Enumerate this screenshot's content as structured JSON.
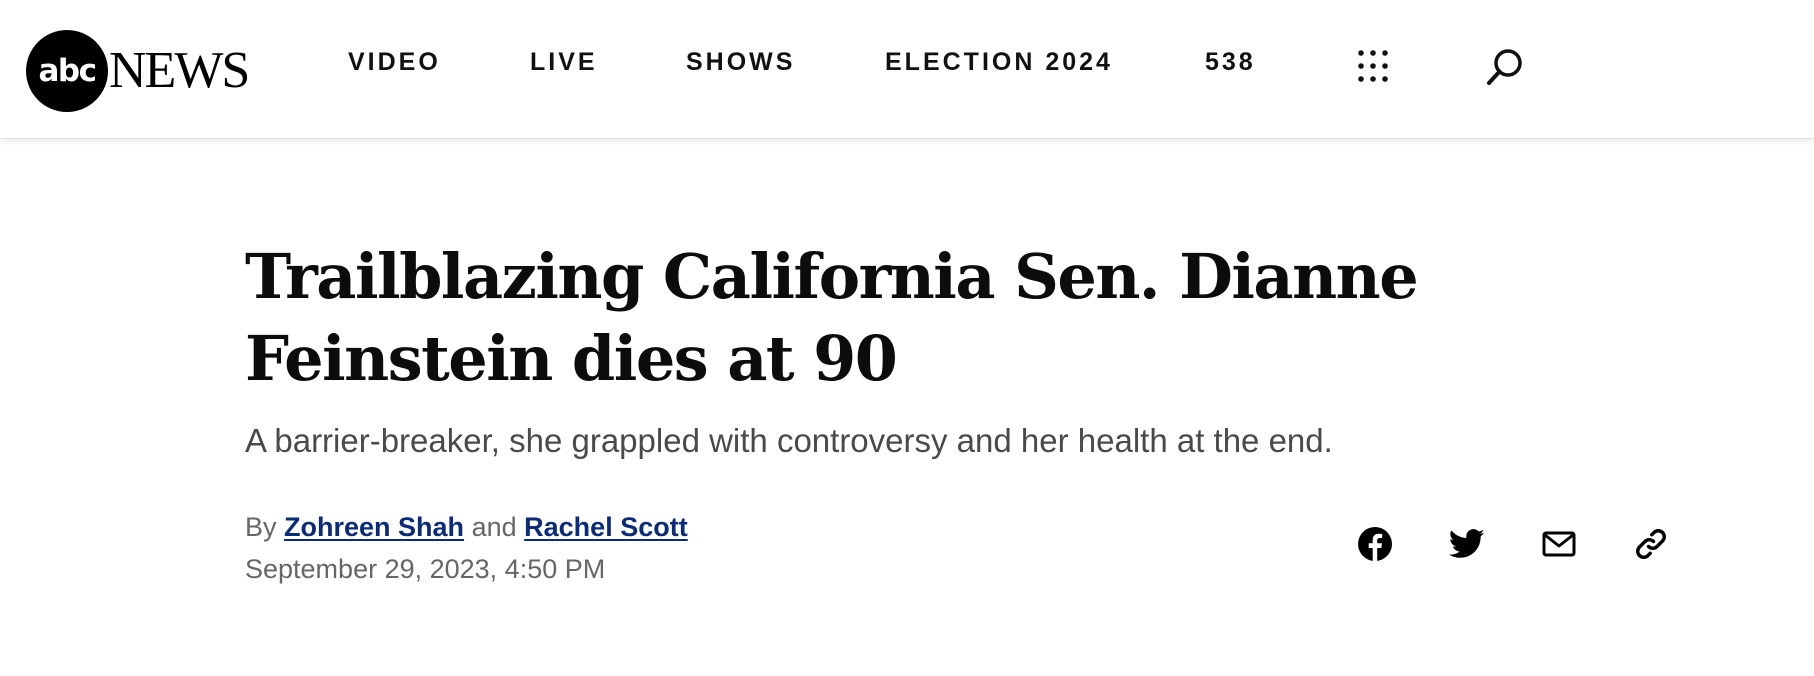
{
  "header": {
    "logo": {
      "mark": "abc",
      "word": "NEWS"
    },
    "nav": [
      {
        "label": "VIDEO"
      },
      {
        "label": "LIVE"
      },
      {
        "label": "SHOWS"
      },
      {
        "label": "ELECTION 2024"
      },
      {
        "label": "538"
      }
    ],
    "icons": {
      "menu": "grid-menu-icon",
      "search": "search-icon"
    }
  },
  "article": {
    "headline": "Trailblazing California Sen. Dianne Feinstein dies at 90",
    "subheadline": "A barrier-breaker, she grappled with controversy and her health at the end.",
    "byline": {
      "prefix": "By",
      "author1": "Zohreen Shah",
      "conjunction": "and",
      "author2": "Rachel Scott"
    },
    "timestamp": "September 29, 2023, 4:50 PM",
    "share": [
      {
        "icon": "facebook-icon"
      },
      {
        "icon": "twitter-icon"
      },
      {
        "icon": "email-icon"
      },
      {
        "icon": "link-icon"
      }
    ]
  },
  "colors": {
    "author_link": "#0a2b7a",
    "subheadline": "#4a4a4a",
    "meta": "#666666"
  }
}
